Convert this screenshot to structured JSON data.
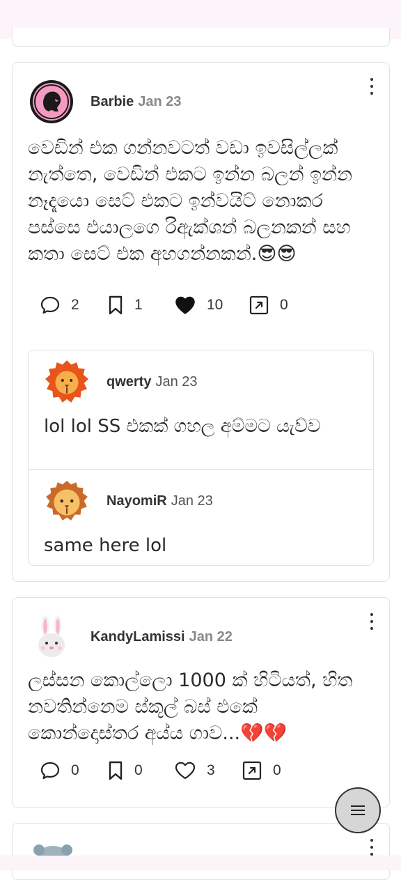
{
  "posts": [
    {
      "author": "Barbie",
      "date": "Jan 23",
      "text": "වෙඩින් එක ගන්නවටත් වඩා ඉවසිල්ලක් නැත්තෙ, වෙඩින් එකට ඉන්න බලන් ඉන්න නෑදෑයො සෙට් එකට ඉන්වයිට් නොකර පස්සෙ එයාලගෙ රිඇක්ශන් බලනකන් සහ කතා සෙට් එක අහගන්නකන්.😎😎",
      "stats": {
        "comments": "2",
        "bookmarks": "1",
        "likes": "10",
        "shares": "0"
      },
      "liked": true,
      "replies": [
        {
          "author": "qwerty",
          "date": "Jan 23",
          "text": "lol lol SS එකක් ගහල අම්මට යැව්ව"
        },
        {
          "author": "NayomiR",
          "date": "Jan 23",
          "text": "same here lol"
        }
      ]
    },
    {
      "author": "KandyLamissi",
      "date": "Jan 22",
      "text": "ලස්සන කොල්ලො 1000 ක් හිටියත්, හිත නවතින්නෙම ස්කූල් බස් එකේ කොන්දොස්තර අය්ය ගාව...💔💔",
      "stats": {
        "comments": "0",
        "bookmarks": "0",
        "likes": "3",
        "shares": "0"
      },
      "liked": false
    }
  ],
  "colors": {
    "accent": "#f49ac1",
    "text": "#2a2a2a",
    "muted": "#888888",
    "fab": "#d6d6d6"
  },
  "icons": [
    "comment-icon",
    "bookmark-icon",
    "heart-icon",
    "share-icon",
    "more-icon",
    "menu-icon"
  ]
}
